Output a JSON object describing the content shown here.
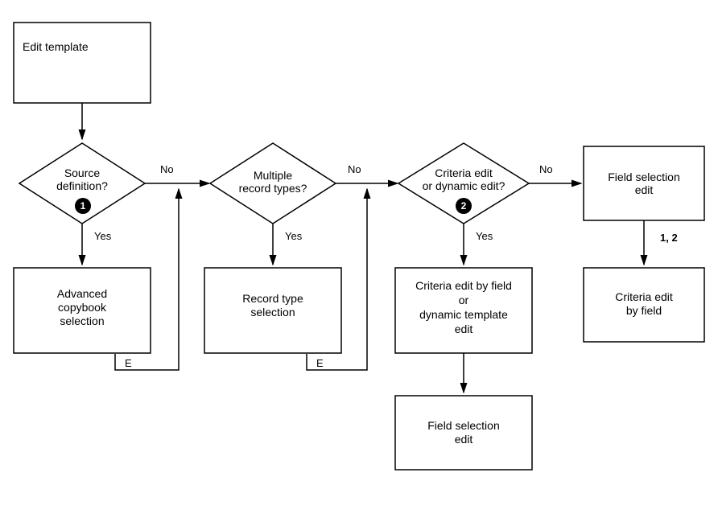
{
  "nodes": {
    "editTemplate": "Edit template",
    "sourceDef1": "Source",
    "sourceDef2": "definition?",
    "multRecord1": "Multiple",
    "multRecord2": "record types?",
    "criteriaEdit1": "Criteria edit",
    "criteriaEdit2": "or dynamic edit?",
    "fieldSel1": "Field selection",
    "fieldSel2": "edit",
    "advCopy1": "Advanced",
    "advCopy2": "copybook",
    "advCopy3": "selection",
    "recordType1": "Record type",
    "recordType2": "selection",
    "critByField1": "Criteria edit by field",
    "critByField2": "or",
    "critByField3": "dynamic template",
    "critByField4": "edit",
    "bottomField1": "Field selection",
    "bottomField2": "edit",
    "rightCrit1": "Criteria edit",
    "rightCrit2": "by field"
  },
  "labels": {
    "yes1": "Yes",
    "yes2": "Yes",
    "yes3": "Yes",
    "no1": "No",
    "no2": "No",
    "no3": "No",
    "e1": "E",
    "e2": "E",
    "one": "1",
    "two": "2",
    "ref12": "1, 2"
  }
}
